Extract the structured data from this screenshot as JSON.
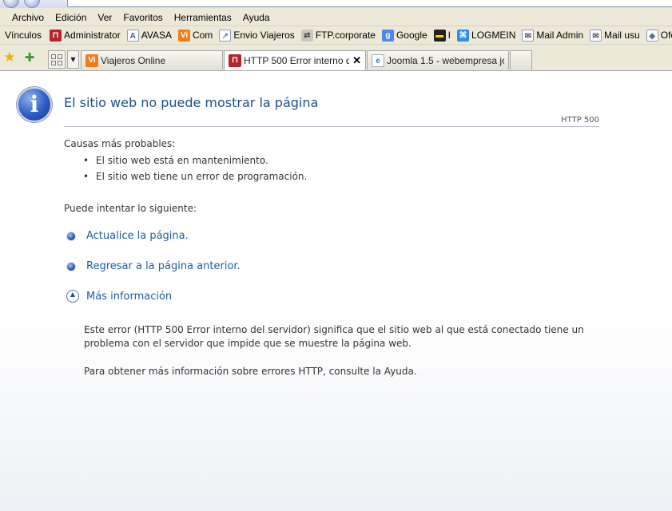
{
  "menu": {
    "items": [
      "Archivo",
      "Edición",
      "Ver",
      "Favoritos",
      "Herramientas",
      "Ayuda"
    ]
  },
  "links_bar": {
    "label": "Vínculos",
    "items": [
      {
        "label": "Administrator",
        "icon": "site-icon",
        "color": "#b5262b"
      },
      {
        "label": "AVASA",
        "icon": "adobe-icon",
        "color": "#3b5a9a"
      },
      {
        "label": "Com",
        "icon": "vi-icon",
        "color": "#f07d1a"
      },
      {
        "label": "Envio Viajeros",
        "icon": "page-icon",
        "color": "#6d7e9a"
      },
      {
        "label": "FTP.corporate",
        "icon": "ftp-icon",
        "color": "#7a8a6a"
      },
      {
        "label": "Google",
        "icon": "google-icon",
        "color": "#4b8be8"
      },
      {
        "label": "I",
        "icon": "black-card-icon",
        "color": "#222222"
      },
      {
        "label": "LOGMEIN",
        "icon": "logmein-icon",
        "color": "#2f8ee4"
      },
      {
        "label": "Mail Admin",
        "icon": "mail-icon",
        "color": "#8d9bb5"
      },
      {
        "label": "Mail usu",
        "icon": "mail-page-icon",
        "color": "#8d9bb5"
      },
      {
        "label": "Ofertes",
        "icon": "offer-icon",
        "color": "#5a6a8a"
      }
    ]
  },
  "tabs": [
    {
      "label": "Viajeros Online",
      "icon": "vi-icon",
      "color": "#f07d1a",
      "active": false
    },
    {
      "label": "HTTP 500 Error interno d...",
      "icon": "site-icon",
      "color": "#b5262b",
      "active": true,
      "close": "✕"
    },
    {
      "label": "Joomla 1.5 - webempresa jo...",
      "icon": "ie-icon",
      "color": "#3a7bd5",
      "active": false
    }
  ],
  "page": {
    "title": "El sitio web no puede mostrar la página",
    "status_code": "HTTP 500",
    "causes_heading": "Causas más probables:",
    "causes": [
      "El sitio web está en mantenimiento.",
      "El sitio web tiene un error de programación."
    ],
    "try_heading": "Puede intentar lo siguiente:",
    "actions": [
      {
        "label": "Actualice la página."
      },
      {
        "label": "Regresar a la página anterior."
      },
      {
        "label": "Más información"
      }
    ],
    "more_info": "Este error (HTTP 500 Error interno del servidor) significa que el sitio web al que está conectado tiene un problema con el servidor que impide que se muestre la página web.",
    "help": "Para obtener más información sobre errores HTTP, consulte la Ayuda."
  }
}
